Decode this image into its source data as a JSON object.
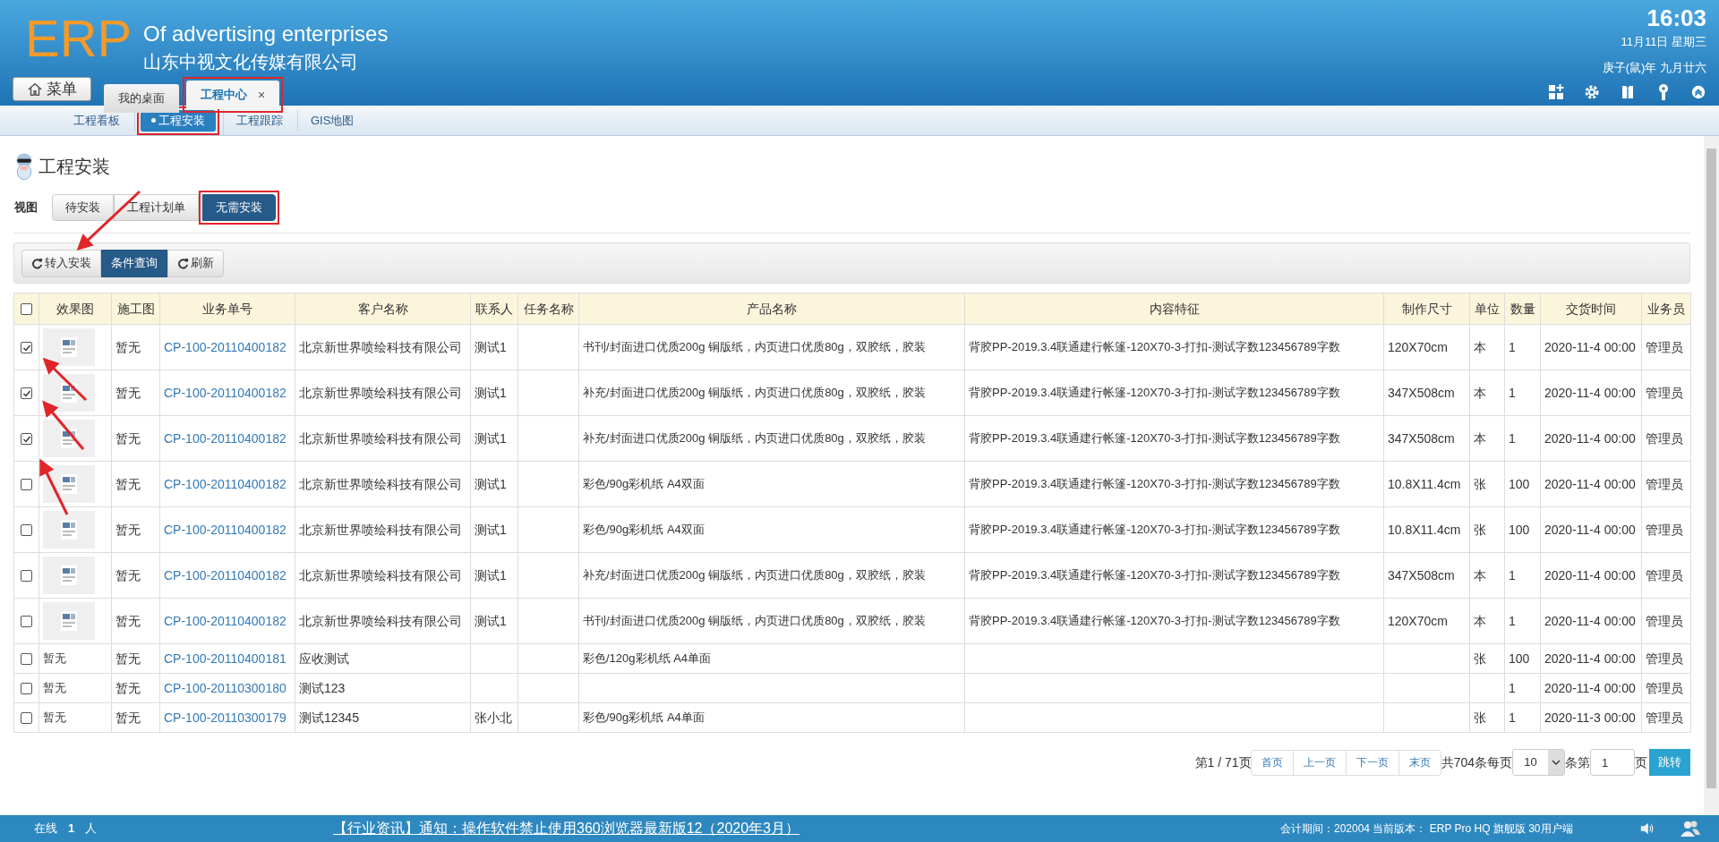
{
  "header": {
    "logo": "ERP",
    "subtitle": "Of advertising enterprises",
    "company": "山东中视文化传媒有限公司",
    "time": "16:03",
    "date": "11月11日 星期三",
    "lunar": "庚子(鼠)年 九月廿六"
  },
  "menu_button": "菜单",
  "tabs": [
    {
      "label": "我的桌面",
      "selected": false,
      "closable": false,
      "highlighted": false
    },
    {
      "label": "工程中心",
      "selected": true,
      "closable": true,
      "highlighted": true
    }
  ],
  "close_glyph": "×",
  "subnav": [
    {
      "label": "工程看板",
      "selected": false,
      "highlighted": false
    },
    {
      "label": "工程安装",
      "selected": true,
      "highlighted": true
    },
    {
      "label": "工程跟踪",
      "selected": false,
      "highlighted": false
    },
    {
      "label": "GIS地图",
      "selected": false,
      "highlighted": false
    }
  ],
  "page_title": "工程安装",
  "view_label": "视图",
  "views": [
    {
      "label": "待安装",
      "selected": false,
      "highlighted": false
    },
    {
      "label": "工程计划单",
      "selected": false,
      "highlighted": false
    },
    {
      "label": "无需安装",
      "selected": true,
      "highlighted": true
    }
  ],
  "actions": [
    {
      "label": "转入安装",
      "kind": "refresh",
      "primary": false
    },
    {
      "label": "条件查询",
      "kind": "plain",
      "primary": true
    },
    {
      "label": "刷新",
      "kind": "refresh",
      "primary": false
    }
  ],
  "table": {
    "select_all": false,
    "effect_column": "效果图",
    "columns": [
      "施工图",
      "业务单号",
      "客户名称",
      "联系人",
      "任务名称",
      "产品名称",
      "内容特征",
      "制作尺寸",
      "单位",
      "数量",
      "交货时间",
      "业务员"
    ],
    "rows": [
      {
        "checked": true,
        "cells": [
          "暂无",
          "CP-100-20110400182",
          "北京新世界喷绘科技有限公司",
          "测试1",
          "",
          "书刊/封面进口优质200g 铜版纸，内页进口优质80g，双胶纸，胶装",
          "背胶PP-2019.3.4联通建行帐篷-120X70-3-打扣-测试字数123456789字数",
          "120X70cm",
          "本",
          "1",
          "2020-11-4 00:00",
          "管理员"
        ]
      },
      {
        "checked": true,
        "cells": [
          "暂无",
          "CP-100-20110400182",
          "北京新世界喷绘科技有限公司",
          "测试1",
          "",
          "补充/封面进口优质200g 铜版纸，内页进口优质80g，双胶纸，胶装",
          "背胶PP-2019.3.4联通建行帐篷-120X70-3-打扣-测试字数123456789字数",
          "347X508cm",
          "本",
          "1",
          "2020-11-4 00:00",
          "管理员"
        ]
      },
      {
        "checked": true,
        "cells": [
          "暂无",
          "CP-100-20110400182",
          "北京新世界喷绘科技有限公司",
          "测试1",
          "",
          "补充/封面进口优质200g 铜版纸，内页进口优质80g，双胶纸，胶装",
          "背胶PP-2019.3.4联通建行帐篷-120X70-3-打扣-测试字数123456789字数",
          "347X508cm",
          "本",
          "1",
          "2020-11-4 00:00",
          "管理员"
        ]
      },
      {
        "checked": false,
        "cells": [
          "暂无",
          "CP-100-20110400182",
          "北京新世界喷绘科技有限公司",
          "测试1",
          "",
          "彩色/90g彩机纸 A4双面",
          "背胶PP-2019.3.4联通建行帐篷-120X70-3-打扣-测试字数123456789字数",
          "10.8X11.4cm",
          "张",
          "100",
          "2020-11-4 00:00",
          "管理员"
        ]
      },
      {
        "checked": false,
        "cells": [
          "暂无",
          "CP-100-20110400182",
          "北京新世界喷绘科技有限公司",
          "测试1",
          "",
          "彩色/90g彩机纸 A4双面",
          "背胶PP-2019.3.4联通建行帐篷-120X70-3-打扣-测试字数123456789字数",
          "10.8X11.4cm",
          "张",
          "100",
          "2020-11-4 00:00",
          "管理员"
        ]
      },
      {
        "checked": false,
        "cells": [
          "暂无",
          "CP-100-20110400182",
          "北京新世界喷绘科技有限公司",
          "测试1",
          "",
          "补充/封面进口优质200g 铜版纸，内页进口优质80g，双胶纸，胶装",
          "背胶PP-2019.3.4联通建行帐篷-120X70-3-打扣-测试字数123456789字数",
          "347X508cm",
          "本",
          "1",
          "2020-11-4 00:00",
          "管理员"
        ]
      },
      {
        "checked": false,
        "cells": [
          "暂无",
          "CP-100-20110400182",
          "北京新世界喷绘科技有限公司",
          "测试1",
          "",
          "书刊/封面进口优质200g 铜版纸，内页进口优质80g，双胶纸，胶装",
          "背胶PP-2019.3.4联通建行帐篷-120X70-3-打扣-测试字数123456789字数",
          "120X70cm",
          "本",
          "1",
          "2020-11-4 00:00",
          "管理员"
        ]
      },
      {
        "checked": false,
        "effect": {
          "kind": "text",
          "text": "暂无"
        },
        "cells": [
          "暂无",
          "CP-100-20110400181",
          "应收测试",
          "",
          "",
          "彩色/120g彩机纸 A4单面",
          "",
          "",
          "张",
          "100",
          "2020-11-4 00:00",
          "管理员"
        ]
      },
      {
        "checked": false,
        "effect": {
          "kind": "text",
          "text": "暂无"
        },
        "cells": [
          "暂无",
          "CP-100-20110300180",
          "测试123",
          "",
          "",
          "",
          "",
          "",
          "",
          "1",
          "2020-11-4 00:00",
          "管理员"
        ]
      },
      {
        "checked": false,
        "effect": {
          "kind": "text",
          "text": "暂无"
        },
        "cells": [
          "暂无",
          "CP-100-20110300179",
          "测试12345",
          "张小北",
          "",
          "彩色/90g彩机纸 A4单面",
          "",
          "",
          "张",
          "1",
          "2020-11-3 00:00",
          "管理员"
        ]
      }
    ]
  },
  "pagination": {
    "page_info": "第1 / 71页",
    "buttons": [
      "首页",
      "上一页",
      "下一页",
      "末页"
    ],
    "total": "共704条每页",
    "page_size": "10",
    "per_label": "条第",
    "page_input": "1",
    "page_suffix": "页",
    "go": "跳转"
  },
  "footer": {
    "online_label": "在线",
    "online_count": "1",
    "online_unit": "人",
    "notice": "【行业资讯】通知：操作软件禁止使用360浏览器最新版12（2020年3月）",
    "version": "会计期间：202004 当前版本： ERP Pro HQ 旗舰版 30用户端"
  }
}
